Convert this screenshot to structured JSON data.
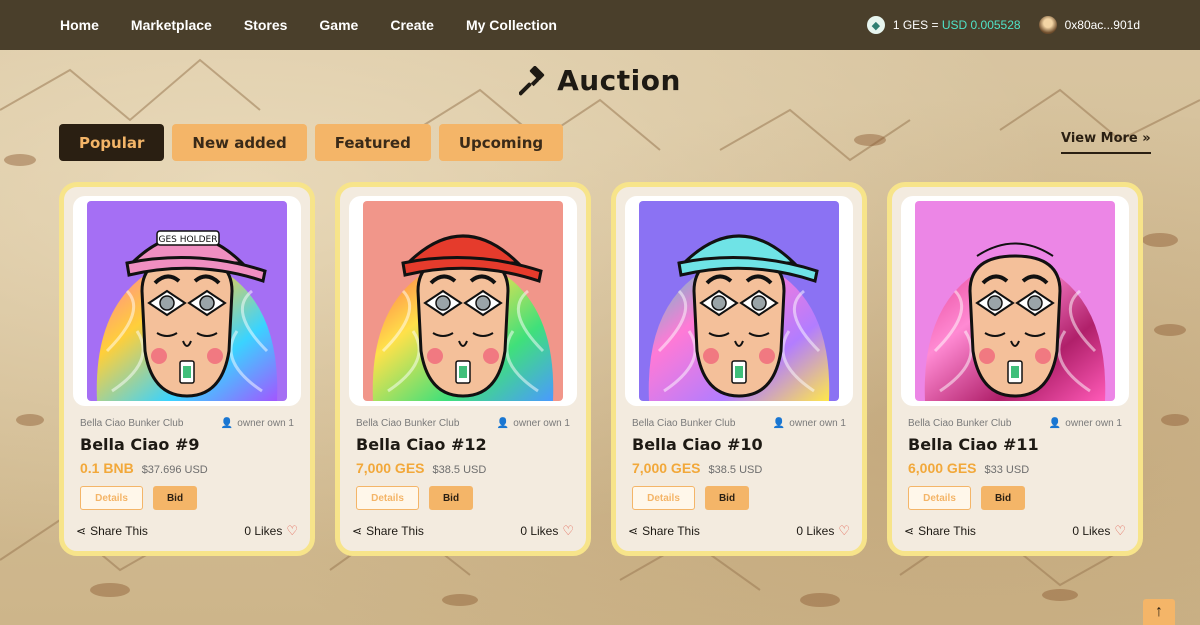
{
  "nav": {
    "items": [
      "Home",
      "Marketplace",
      "Stores",
      "Game",
      "Create",
      "My Collection"
    ]
  },
  "rate": {
    "text_pre": "1 GES = ",
    "text_usd": "USD 0.005528"
  },
  "wallet": {
    "address": "0x80ac...901d"
  },
  "section": {
    "title": "Auction",
    "icon": "gavel-icon"
  },
  "tabs": [
    {
      "label": "Popular",
      "active": true
    },
    {
      "label": "New added",
      "active": false
    },
    {
      "label": "Featured",
      "active": false
    },
    {
      "label": "Upcoming",
      "active": false
    }
  ],
  "view_more": {
    "label": "View More",
    "chevron": "»"
  },
  "cards": [
    {
      "collection": "Bella Ciao Bunker Club",
      "owner": "owner own 1",
      "name": "Bella Ciao #9",
      "price": "0.1 BNB",
      "usd": "$37.696 USD",
      "details": "Details",
      "bid": "Bid",
      "share": "Share This",
      "likes": "0 Likes",
      "bg_color": "#a56ff4",
      "hat_color": "#f08fc1",
      "hat_text": "GES HOLDER",
      "swirl": [
        "#ff6fb1",
        "#ffcf3a",
        "#3ad3ff",
        "#a256ff"
      ]
    },
    {
      "collection": "Bella Ciao Bunker Club",
      "owner": "owner own 1",
      "name": "Bella Ciao #12",
      "price": "7,000 GES",
      "usd": "$38.5 USD",
      "details": "Details",
      "bid": "Bid",
      "share": "Share This",
      "likes": "0 Likes",
      "bg_color": "#f1968a",
      "hat_color": "#e53b2c",
      "hat_text": "",
      "swirl": [
        "#ff5a4a",
        "#ffe14a",
        "#40e07a",
        "#4a9aff"
      ]
    },
    {
      "collection": "Bella Ciao Bunker Club",
      "owner": "owner own 1",
      "name": "Bella Ciao #10",
      "price": "7,000 GES",
      "usd": "$38.5 USD",
      "details": "Details",
      "bid": "Bid",
      "share": "Share This",
      "likes": "0 Likes",
      "bg_color": "#8b72f3",
      "hat_color": "#6fe3e6",
      "hat_text": "",
      "swirl": [
        "#3ad3c4",
        "#ff7ad6",
        "#b27dff",
        "#ffe84a"
      ]
    },
    {
      "collection": "Bella Ciao Bunker Club",
      "owner": "owner own 1",
      "name": "Bella Ciao #11",
      "price": "6,000 GES",
      "usd": "$33 USD",
      "details": "Details",
      "bid": "Bid",
      "share": "Share This",
      "likes": "0 Likes",
      "bg_color": "#ec86e6",
      "hat_color": "",
      "hat_text": "",
      "swirl": [
        "#e23b8f",
        "#ff8ad3",
        "#b0206a",
        "#ff5ab8"
      ]
    }
  ],
  "scroll_top": {
    "icon": "arrow-up-icon",
    "glyph": "↑"
  }
}
